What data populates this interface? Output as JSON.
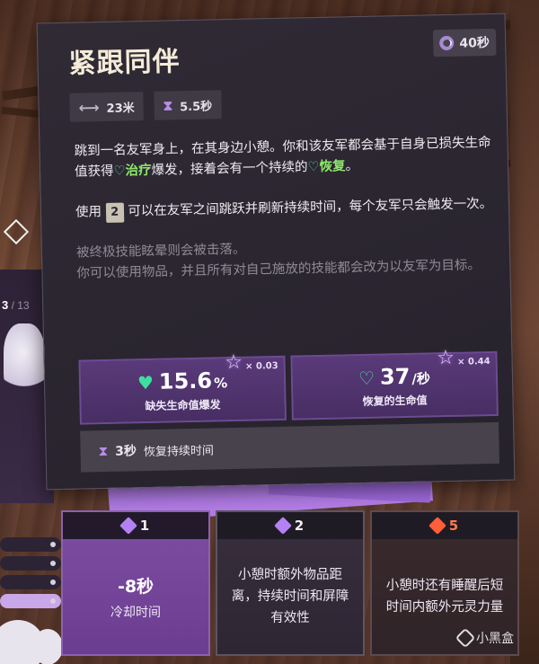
{
  "ability": {
    "title": "紧跟同伴",
    "cooldown": "40秒",
    "range": "23米",
    "cast_time": "5.5秒",
    "desc1_pre": "跳到一名友军身上，在其身边小憩。你和该友军都会基于自身已损失生命值获得",
    "desc1_heal": "治疗",
    "desc1_mid": "爆发，接着会有一个持续的",
    "desc1_restore": "恢复",
    "desc1_end": "。",
    "desc2_pre": "使用",
    "desc2_key": "2",
    "desc2_post": "可以在友军之间跳跃并刷新持续时间，每个友军只会触发一次。",
    "desc3_line1": "被终极技能眩晕则会被击落。",
    "desc3_line2": "你可以使用物品，并且所有对自己施放的技能都会改为以友军为目标。"
  },
  "effects": [
    {
      "value": "15.6",
      "unit": "%",
      "label": "缺失生命值爆发",
      "scale": "× 0.03"
    },
    {
      "value": "37",
      "unit": "/秒",
      "label": "恢复的生命值",
      "scale": "× 0.44"
    }
  ],
  "duration": {
    "value": "3秒",
    "label": "恢复持续时间"
  },
  "upgrades": [
    {
      "cost": "1",
      "big": "-8秒",
      "text": "冷却时间"
    },
    {
      "cost": "2",
      "text": "小憩时额外物品距离，持续时间和屏障有效性"
    },
    {
      "cost": "5",
      "text": "小憩时还有睡醒后短时间内额外元灵力量"
    }
  ],
  "background": {
    "counter_current": "3",
    "counter_total": "/ 13"
  },
  "watermark": "小黑盒",
  "colors": {
    "accent_purple": "#7e4ea3",
    "heal_green": "#8de86b",
    "red_gem": "#ff5e3a"
  }
}
